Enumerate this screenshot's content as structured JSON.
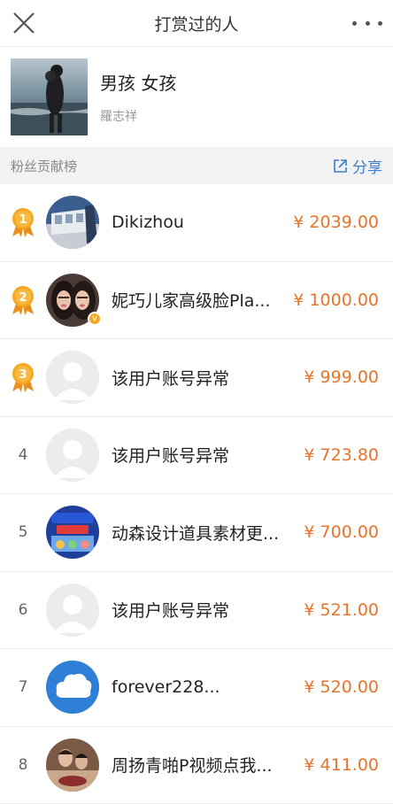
{
  "header": {
    "title": "打赏过的人"
  },
  "post": {
    "title": "男孩 女孩",
    "author": "羅志祥"
  },
  "board": {
    "label": "粉丝贡献榜",
    "share_label": "分享"
  },
  "rows": [
    {
      "rank": "1",
      "name": "Dikizhou",
      "amount": "¥ 2039.00"
    },
    {
      "rank": "2",
      "name": "妮巧儿家高级脸Pla...",
      "amount": "¥ 1000.00"
    },
    {
      "rank": "3",
      "name": "该用户账号异常",
      "amount": "¥ 999.00"
    },
    {
      "rank": "4",
      "name": "该用户账号异常",
      "amount": "¥ 723.80"
    },
    {
      "rank": "5",
      "name": "动森设计道具素材更...",
      "amount": "¥ 700.00"
    },
    {
      "rank": "6",
      "name": "该用户账号异常",
      "amount": "¥ 521.00"
    },
    {
      "rank": "7",
      "name": "forever228...",
      "amount": "¥ 520.00"
    },
    {
      "rank": "8",
      "name": "周扬青啪P视频点我...",
      "amount": "¥ 411.00"
    }
  ],
  "colors": {
    "amount": "#e8732a",
    "share": "#3b7fd0",
    "medal": "#f6a821"
  },
  "icons": {
    "close": "close-icon",
    "more": "more-icon",
    "share": "share-icon",
    "medal": "medal-icon"
  }
}
